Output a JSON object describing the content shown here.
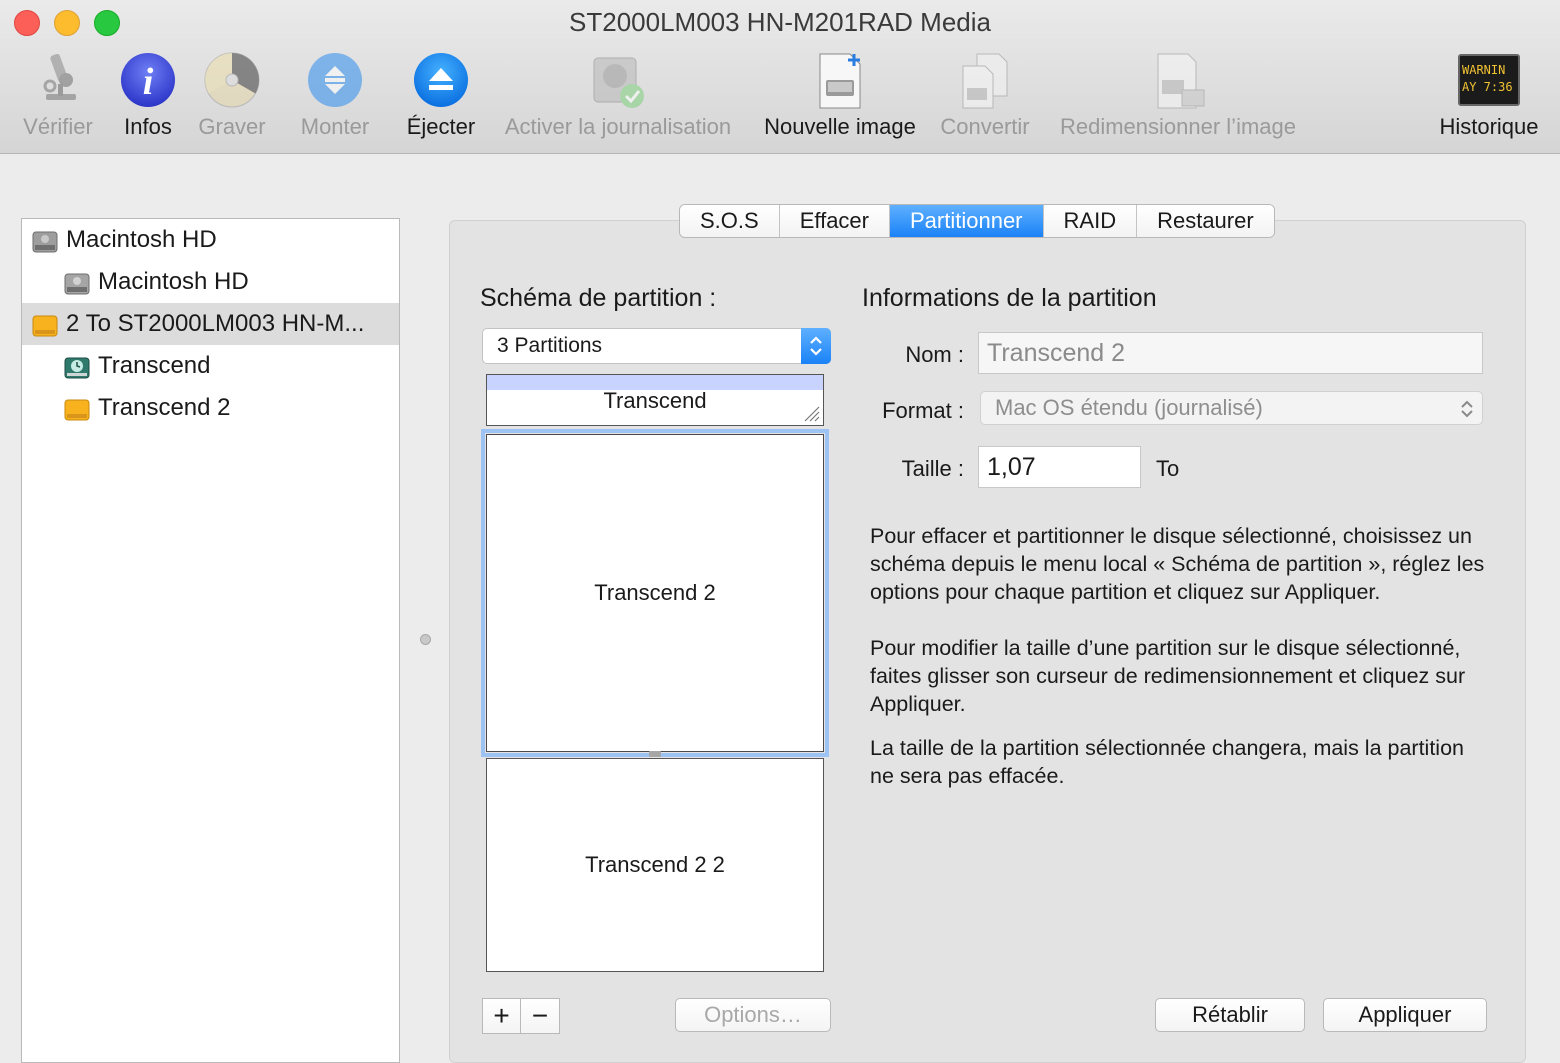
{
  "window": {
    "title": "ST2000LM003 HN-M201RAD Media"
  },
  "toolbar": {
    "items": [
      {
        "label": "Vérifier",
        "icon": "microscope-icon",
        "enabled": false
      },
      {
        "label": "Infos",
        "icon": "info-icon",
        "enabled": true
      },
      {
        "label": "Graver",
        "icon": "burn-icon",
        "enabled": false
      },
      {
        "label": "Monter",
        "icon": "mount-icon",
        "enabled": false
      },
      {
        "label": "Éjecter",
        "icon": "eject-icon",
        "enabled": true
      },
      {
        "label": "Activer la journalisation",
        "icon": "journaling-icon",
        "enabled": false
      },
      {
        "label": "Nouvelle image",
        "icon": "new-image-icon",
        "enabled": true
      },
      {
        "label": "Convertir",
        "icon": "convert-icon",
        "enabled": false
      },
      {
        "label": "Redimensionner l’image",
        "icon": "resize-image-icon",
        "enabled": false
      },
      {
        "label": "Historique",
        "icon": "log-icon",
        "enabled": true
      }
    ],
    "log_icon_text": [
      "WARNIN",
      "AY 7:36"
    ]
  },
  "sidebar": {
    "items": [
      {
        "label": "Macintosh HD",
        "level": 0,
        "icon": "internal-disk-icon",
        "selected": false
      },
      {
        "label": "Macintosh HD",
        "level": 1,
        "icon": "internal-volume-icon",
        "selected": false
      },
      {
        "label": "2 To ST2000LM003 HN-M...",
        "level": 0,
        "icon": "external-disk-icon",
        "selected": true
      },
      {
        "label": "Transcend",
        "level": 1,
        "icon": "time-machine-volume-icon",
        "selected": false
      },
      {
        "label": "Transcend 2",
        "level": 1,
        "icon": "external-volume-icon",
        "selected": false
      }
    ]
  },
  "tabs": [
    {
      "label": "S.O.S",
      "active": false
    },
    {
      "label": "Effacer",
      "active": false
    },
    {
      "label": "Partitionner",
      "active": true
    },
    {
      "label": "RAID",
      "active": false
    },
    {
      "label": "Restaurer",
      "active": false
    }
  ],
  "scheme": {
    "title": "Schéma de partition :",
    "selected": "3 Partitions",
    "partitions": [
      {
        "name": "Transcend",
        "used_fraction": 0.3
      },
      {
        "name": "Transcend 2",
        "selected": true
      },
      {
        "name": "Transcend 2 2"
      }
    ],
    "add_label": "+",
    "remove_label": "−",
    "options_label": "Options…"
  },
  "info": {
    "title": "Informations de la partition",
    "name_label": "Nom :",
    "name_value": "Transcend 2",
    "format_label": "Format :",
    "format_value": "Mac OS étendu (journalisé)",
    "size_label": "Taille :",
    "size_value": "1,07",
    "size_unit": "To",
    "help_1": "Pour effacer et partitionner le disque sélectionné, choisissez un schéma depuis le menu local « Schéma de partition », réglez les options pour chaque partition et cliquez sur Appliquer.",
    "help_2": "Pour modifier la taille d’une partition sur le disque sélectionné, faites glisser son curseur de redimensionnement et cliquez sur Appliquer.",
    "help_3": "La taille de la partition sélectionnée changera, mais la partition ne sera pas effacée."
  },
  "buttons": {
    "revert": "Rétablir",
    "apply": "Appliquer"
  },
  "colors": {
    "accent": "#1a82f7",
    "selection_outline": "#9cc3f3",
    "used_space": "#c8d3ff"
  }
}
